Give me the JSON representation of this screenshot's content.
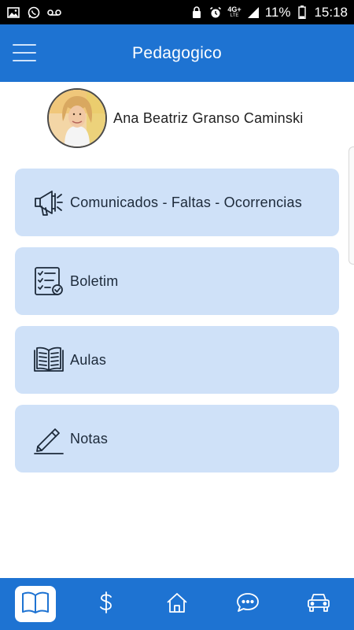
{
  "status_bar": {
    "network_label": "4G+",
    "network_sub": "LTE",
    "battery_percent": "11%",
    "time": "15:18"
  },
  "app_bar": {
    "title": "Pedagogico"
  },
  "profile": {
    "name": "Ana Beatriz Granso Caminski"
  },
  "menu": [
    {
      "label": "Comunicados - Faltas - Ocorrencias",
      "icon": "megaphone-icon"
    },
    {
      "label": "Boletim",
      "icon": "checklist-icon"
    },
    {
      "label": "Aulas",
      "icon": "book-icon"
    },
    {
      "label": "Notas",
      "icon": "pencil-icon"
    }
  ],
  "bottom_nav": [
    {
      "icon": "open-book-icon",
      "active": true
    },
    {
      "icon": "dollar-icon",
      "active": false
    },
    {
      "icon": "home-icon",
      "active": false
    },
    {
      "icon": "chat-icon",
      "active": false
    },
    {
      "icon": "car-icon",
      "active": false
    }
  ],
  "colors": {
    "primary": "#1e73d2",
    "card": "#cfe1f8",
    "icon_stroke": "#1d2a3a"
  }
}
